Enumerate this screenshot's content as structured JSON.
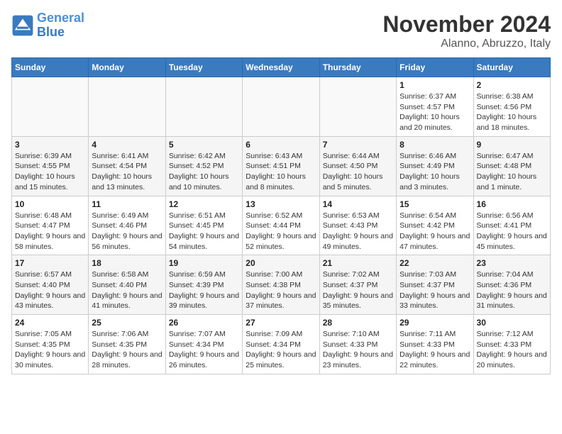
{
  "header": {
    "logo_line1": "General",
    "logo_line2": "Blue",
    "month_title": "November 2024",
    "location": "Alanno, Abruzzo, Italy"
  },
  "weekdays": [
    "Sunday",
    "Monday",
    "Tuesday",
    "Wednesday",
    "Thursday",
    "Friday",
    "Saturday"
  ],
  "weeks": [
    [
      {
        "day": "",
        "info": ""
      },
      {
        "day": "",
        "info": ""
      },
      {
        "day": "",
        "info": ""
      },
      {
        "day": "",
        "info": ""
      },
      {
        "day": "",
        "info": ""
      },
      {
        "day": "1",
        "info": "Sunrise: 6:37 AM\nSunset: 4:57 PM\nDaylight: 10 hours and 20 minutes."
      },
      {
        "day": "2",
        "info": "Sunrise: 6:38 AM\nSunset: 4:56 PM\nDaylight: 10 hours and 18 minutes."
      }
    ],
    [
      {
        "day": "3",
        "info": "Sunrise: 6:39 AM\nSunset: 4:55 PM\nDaylight: 10 hours and 15 minutes."
      },
      {
        "day": "4",
        "info": "Sunrise: 6:41 AM\nSunset: 4:54 PM\nDaylight: 10 hours and 13 minutes."
      },
      {
        "day": "5",
        "info": "Sunrise: 6:42 AM\nSunset: 4:52 PM\nDaylight: 10 hours and 10 minutes."
      },
      {
        "day": "6",
        "info": "Sunrise: 6:43 AM\nSunset: 4:51 PM\nDaylight: 10 hours and 8 minutes."
      },
      {
        "day": "7",
        "info": "Sunrise: 6:44 AM\nSunset: 4:50 PM\nDaylight: 10 hours and 5 minutes."
      },
      {
        "day": "8",
        "info": "Sunrise: 6:46 AM\nSunset: 4:49 PM\nDaylight: 10 hours and 3 minutes."
      },
      {
        "day": "9",
        "info": "Sunrise: 6:47 AM\nSunset: 4:48 PM\nDaylight: 10 hours and 1 minute."
      }
    ],
    [
      {
        "day": "10",
        "info": "Sunrise: 6:48 AM\nSunset: 4:47 PM\nDaylight: 9 hours and 58 minutes."
      },
      {
        "day": "11",
        "info": "Sunrise: 6:49 AM\nSunset: 4:46 PM\nDaylight: 9 hours and 56 minutes."
      },
      {
        "day": "12",
        "info": "Sunrise: 6:51 AM\nSunset: 4:45 PM\nDaylight: 9 hours and 54 minutes."
      },
      {
        "day": "13",
        "info": "Sunrise: 6:52 AM\nSunset: 4:44 PM\nDaylight: 9 hours and 52 minutes."
      },
      {
        "day": "14",
        "info": "Sunrise: 6:53 AM\nSunset: 4:43 PM\nDaylight: 9 hours and 49 minutes."
      },
      {
        "day": "15",
        "info": "Sunrise: 6:54 AM\nSunset: 4:42 PM\nDaylight: 9 hours and 47 minutes."
      },
      {
        "day": "16",
        "info": "Sunrise: 6:56 AM\nSunset: 4:41 PM\nDaylight: 9 hours and 45 minutes."
      }
    ],
    [
      {
        "day": "17",
        "info": "Sunrise: 6:57 AM\nSunset: 4:40 PM\nDaylight: 9 hours and 43 minutes."
      },
      {
        "day": "18",
        "info": "Sunrise: 6:58 AM\nSunset: 4:40 PM\nDaylight: 9 hours and 41 minutes."
      },
      {
        "day": "19",
        "info": "Sunrise: 6:59 AM\nSunset: 4:39 PM\nDaylight: 9 hours and 39 minutes."
      },
      {
        "day": "20",
        "info": "Sunrise: 7:00 AM\nSunset: 4:38 PM\nDaylight: 9 hours and 37 minutes."
      },
      {
        "day": "21",
        "info": "Sunrise: 7:02 AM\nSunset: 4:37 PM\nDaylight: 9 hours and 35 minutes."
      },
      {
        "day": "22",
        "info": "Sunrise: 7:03 AM\nSunset: 4:37 PM\nDaylight: 9 hours and 33 minutes."
      },
      {
        "day": "23",
        "info": "Sunrise: 7:04 AM\nSunset: 4:36 PM\nDaylight: 9 hours and 31 minutes."
      }
    ],
    [
      {
        "day": "24",
        "info": "Sunrise: 7:05 AM\nSunset: 4:35 PM\nDaylight: 9 hours and 30 minutes."
      },
      {
        "day": "25",
        "info": "Sunrise: 7:06 AM\nSunset: 4:35 PM\nDaylight: 9 hours and 28 minutes."
      },
      {
        "day": "26",
        "info": "Sunrise: 7:07 AM\nSunset: 4:34 PM\nDaylight: 9 hours and 26 minutes."
      },
      {
        "day": "27",
        "info": "Sunrise: 7:09 AM\nSunset: 4:34 PM\nDaylight: 9 hours and 25 minutes."
      },
      {
        "day": "28",
        "info": "Sunrise: 7:10 AM\nSunset: 4:33 PM\nDaylight: 9 hours and 23 minutes."
      },
      {
        "day": "29",
        "info": "Sunrise: 7:11 AM\nSunset: 4:33 PM\nDaylight: 9 hours and 22 minutes."
      },
      {
        "day": "30",
        "info": "Sunrise: 7:12 AM\nSunset: 4:33 PM\nDaylight: 9 hours and 20 minutes."
      }
    ]
  ]
}
